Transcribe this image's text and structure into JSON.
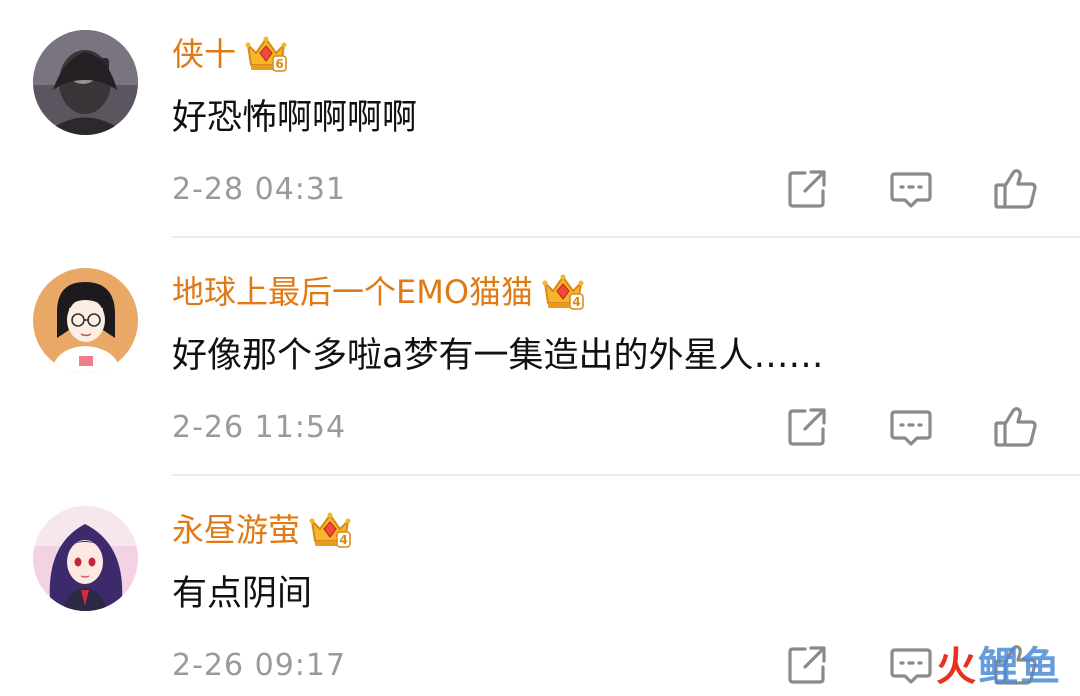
{
  "comments": [
    {
      "username": "侠十",
      "badge_level": "6",
      "text": "好恐怖啊啊啊啊",
      "time": "2-28 04:31"
    },
    {
      "username": "地球上最后一个EMO猫猫",
      "badge_level": "4",
      "text": "好像那个多啦a梦有一集造出的外星人……",
      "time": "2-26 11:54"
    },
    {
      "username": "永昼游萤",
      "badge_level": "4",
      "text": "有点阴间",
      "time": "2-26 09:17"
    }
  ],
  "icons": {
    "share": "share-icon",
    "comment": "comment-icon",
    "like": "thumbs-up-icon",
    "badge": "crown-badge-icon"
  },
  "colors": {
    "username": "#e07a17",
    "text": "#111111",
    "time": "#9a9a9a",
    "icon": "#8a8a8a",
    "divider": "#ececec"
  },
  "watermark": {
    "part1": "火",
    "part2": "鲤鱼"
  }
}
